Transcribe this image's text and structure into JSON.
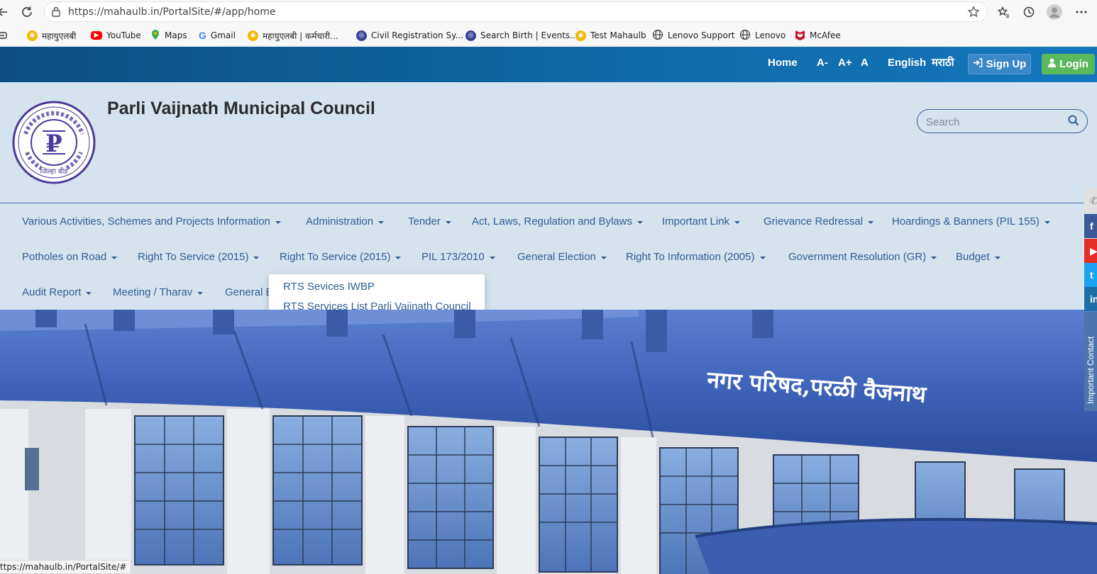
{
  "browser": {
    "url": "https://mahaulb.in/PortalSite/#/app/home",
    "bookmarks": [
      {
        "label": "महायुएलबी",
        "icon": "mahaulb-icon",
        "color": "#f2b807"
      },
      {
        "label": "YouTube",
        "icon": "youtube-icon",
        "color": "#ff0000"
      },
      {
        "label": "Maps",
        "icon": "maps-icon",
        "color": "#34a853"
      },
      {
        "label": "Gmail",
        "icon": "google-icon",
        "color": "#4285f4"
      },
      {
        "label": "महायुएलबी | कर्मचारी...",
        "icon": "mahaulb-icon",
        "color": "#f2b807"
      },
      {
        "label": "Civil Registration Sy...",
        "icon": "crs-icon",
        "color": "#3a3f9c"
      },
      {
        "label": "Search Birth | Events...",
        "icon": "crs-icon",
        "color": "#3a3f9c"
      },
      {
        "label": "Test Mahaulb",
        "icon": "mahaulb-icon",
        "color": "#f2b807"
      },
      {
        "label": "Lenovo Support",
        "icon": "globe-icon",
        "color": "#555555"
      },
      {
        "label": "Lenovo",
        "icon": "globe-icon",
        "color": "#555555"
      },
      {
        "label": "McAfee",
        "icon": "mcafee-icon",
        "color": "#c8102e"
      }
    ],
    "status_url": "ttps://mahaulb.in/PortalSite/#"
  },
  "topbar": {
    "home": "Home",
    "font_decrease": "A-",
    "font_increase": "A+",
    "font_reset": "A",
    "lang_english": "English",
    "lang_marathi": "मराठी",
    "signup": "Sign Up",
    "login": "Login",
    "colors": {
      "bar": "#0b4f86",
      "login": "#5cb85c",
      "signup": "#3a87c8"
    }
  },
  "header": {
    "title": "Parli Vaijnath Municipal Council",
    "search_placeholder": "Search",
    "logo_text": "जिल्हा बीड"
  },
  "nav": {
    "row1": [
      "Various Activities, Schemes and Projects Information",
      "Administration",
      "Tender",
      "Act, Laws, Regulation and Bylaws",
      "Important Link",
      "Grievance Redressal",
      "Hoardings & Banners (PIL 155)"
    ],
    "row2": [
      "Potholes on Road",
      "Right To Service (2015)",
      "Right To Service (2015)",
      "PIL 173/2010",
      "General Election",
      "Right To Information (2005)",
      "Government Resolution (GR)",
      "Budget"
    ],
    "row3": [
      "Audit Report",
      "Meeting / Tharav",
      "General E"
    ],
    "dropdown": [
      "RTS Sevices IWBP",
      "RTS Services List Parli Vaijnath Council"
    ]
  },
  "hero": {
    "building_sign": "नगर परिषद,परळी वैजनाथ"
  },
  "sidebar": {
    "contact_label": "Important Contact",
    "social": [
      {
        "name": "phone",
        "icon": "phone-icon",
        "color": "#e0e0e0",
        "glyph": "✆"
      },
      {
        "name": "facebook",
        "icon": "facebook-icon",
        "color": "#3b5998",
        "glyph": "f"
      },
      {
        "name": "youtube",
        "icon": "youtube-icon",
        "color": "#e52d27",
        "glyph": "▶"
      },
      {
        "name": "twitter",
        "icon": "twitter-icon",
        "color": "#1da1f2",
        "glyph": "t"
      },
      {
        "name": "linkedin",
        "icon": "linkedin-icon",
        "color": "#1e6fa8",
        "glyph": "in"
      }
    ]
  }
}
